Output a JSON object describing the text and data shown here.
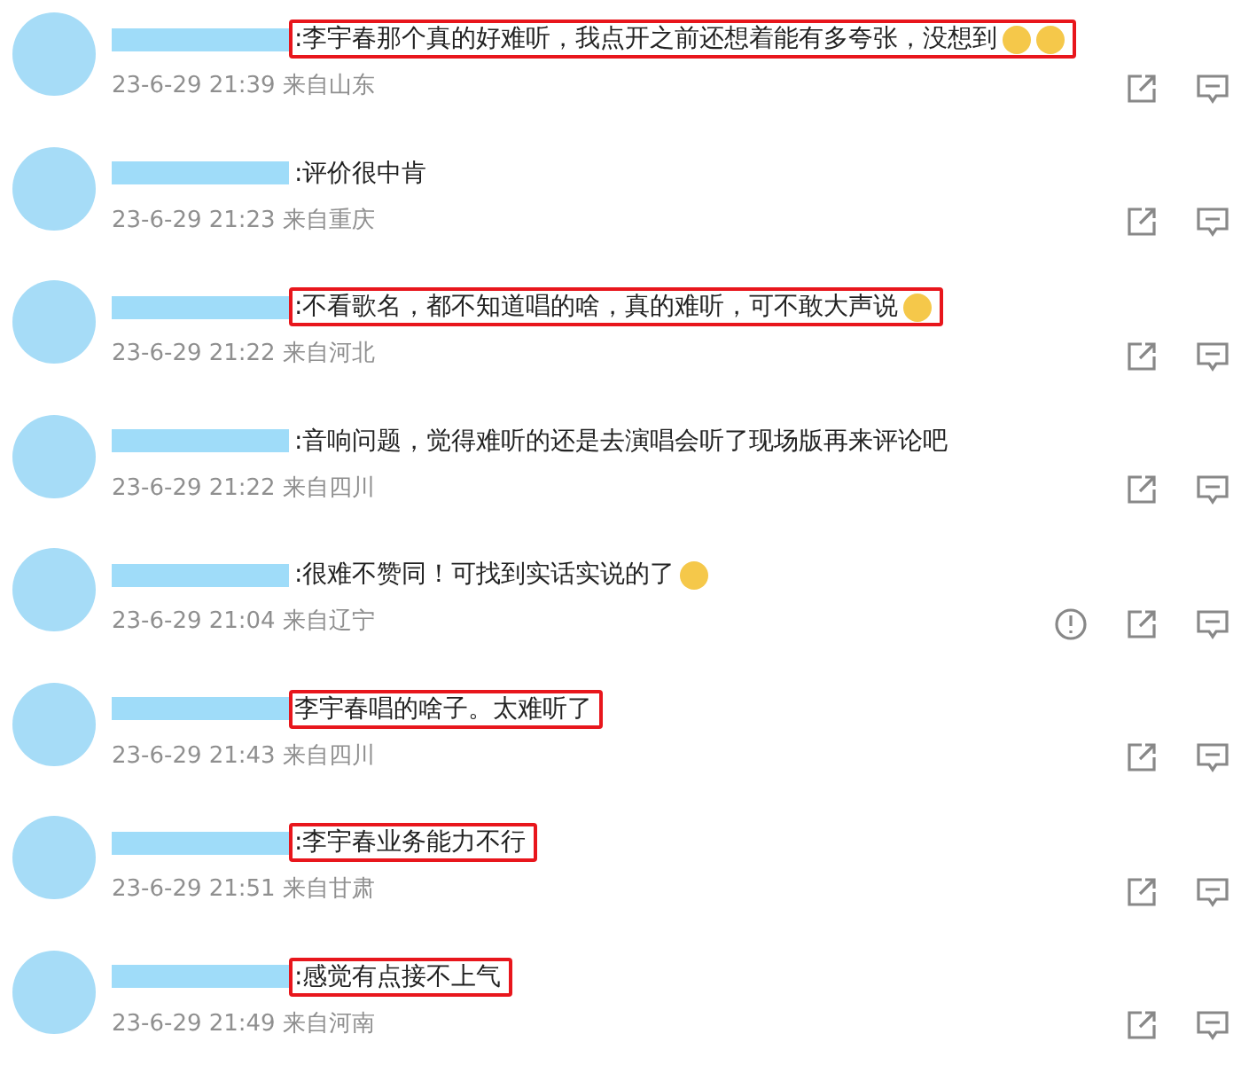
{
  "comments": [
    {
      "text": ":李宇春那个真的好难听，我点开之前还想着能有多夸张，没想到",
      "emojis": [
        {
          "kind": "emoji"
        },
        {
          "kind": "emoji"
        }
      ],
      "highlighted": true,
      "time": "23-6-29 21:39",
      "location": "来自山东",
      "actions": [
        {
          "kind": "share"
        },
        {
          "kind": "reply"
        }
      ]
    },
    {
      "text": ":评价很中肯",
      "highlighted": false,
      "time": "23-6-29 21:23",
      "location": "来自重庆",
      "actions": [
        {
          "kind": "share"
        },
        {
          "kind": "reply"
        }
      ]
    },
    {
      "text": ":不看歌名，都不知道唱的啥，真的难听，可不敢大声说",
      "emojis": [
        {
          "kind": "emoji"
        }
      ],
      "highlighted": true,
      "time": "23-6-29 21:22",
      "location": "来自河北",
      "actions": [
        {
          "kind": "share"
        },
        {
          "kind": "reply"
        }
      ]
    },
    {
      "text": ":音响问题，觉得难听的还是去演唱会听了现场版再来评论吧",
      "highlighted": false,
      "time": "23-6-29 21:22",
      "location": "来自四川",
      "actions": [
        {
          "kind": "share"
        },
        {
          "kind": "reply"
        }
      ]
    },
    {
      "text": ":很难不赞同！可找到实话实说的了",
      "emojis": [
        {
          "kind": "emoji"
        }
      ],
      "highlighted": false,
      "time": "23-6-29 21:04",
      "location": "来自辽宁",
      "actions": [
        {
          "kind": "report"
        },
        {
          "kind": "share"
        },
        {
          "kind": "reply"
        }
      ]
    },
    {
      "text": "李宇春唱的啥子。太难听了",
      "highlighted": true,
      "time": "23-6-29 21:43",
      "location": "来自四川",
      "actions": [
        {
          "kind": "share"
        },
        {
          "kind": "reply"
        }
      ]
    },
    {
      "text": ":李宇春业务能力不行",
      "highlighted": true,
      "time": "23-6-29 21:51",
      "location": "来自甘肃",
      "actions": [
        {
          "kind": "share"
        },
        {
          "kind": "reply"
        }
      ]
    },
    {
      "text": ":感觉有点接不上气",
      "highlighted": true,
      "time": "23-6-29 21:49",
      "location": "来自河南",
      "actions": [
        {
          "kind": "share"
        },
        {
          "kind": "reply"
        }
      ]
    }
  ]
}
